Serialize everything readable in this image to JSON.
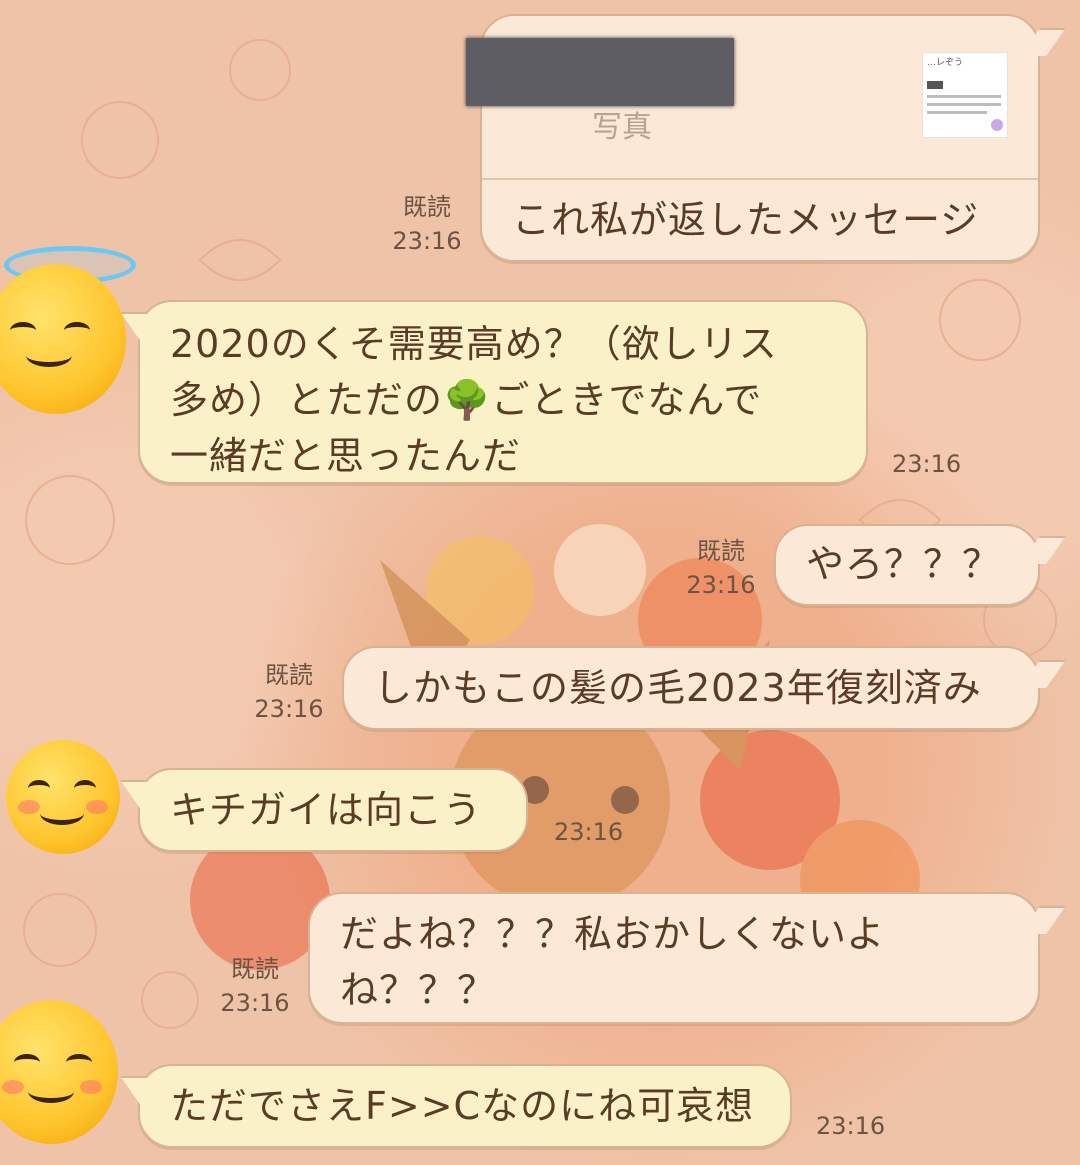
{
  "messages": [
    {
      "id": "m1",
      "side": "out",
      "quote_label": "写真",
      "thumb_title": "…レぞう",
      "text": "これ私が返したメッセージ",
      "read": "既読",
      "time": "23:16"
    },
    {
      "id": "m2",
      "side": "in",
      "text": "2020のくそ需要高め？（欲しリス\n多め）とただの🌳ごときでなんで\n一緒だと思ったんだ",
      "time": "23:16"
    },
    {
      "id": "m3",
      "side": "out",
      "text": "やろ？？？",
      "read": "既読",
      "time": "23:16"
    },
    {
      "id": "m4",
      "side": "out",
      "text": "しかもこの髪の毛2023年復刻済み",
      "read": "既読",
      "time": "23:16"
    },
    {
      "id": "m5",
      "side": "in",
      "text": "キチガイは向こう",
      "time": "23:16"
    },
    {
      "id": "m6",
      "side": "out",
      "text": "だよね？？？私おかしくないよ\nね？？？",
      "read": "既読",
      "time": "23:16"
    },
    {
      "id": "m7",
      "side": "in",
      "text": "ただでさえF>>Cなのにね可哀想",
      "time": "23:16"
    }
  ],
  "avatars": {
    "a1": "smiling-face-with-halo",
    "a2": "smiling-face-with-smiling-eyes",
    "a3": "smiling-face-with-smiling-eyes"
  },
  "colors": {
    "background": "#efc3a8",
    "outgoing_bubble": "#fbe8d7",
    "incoming_bubble": "#fbf1c9",
    "bubble_border": "#d7b395",
    "text": "#5a3b25"
  }
}
